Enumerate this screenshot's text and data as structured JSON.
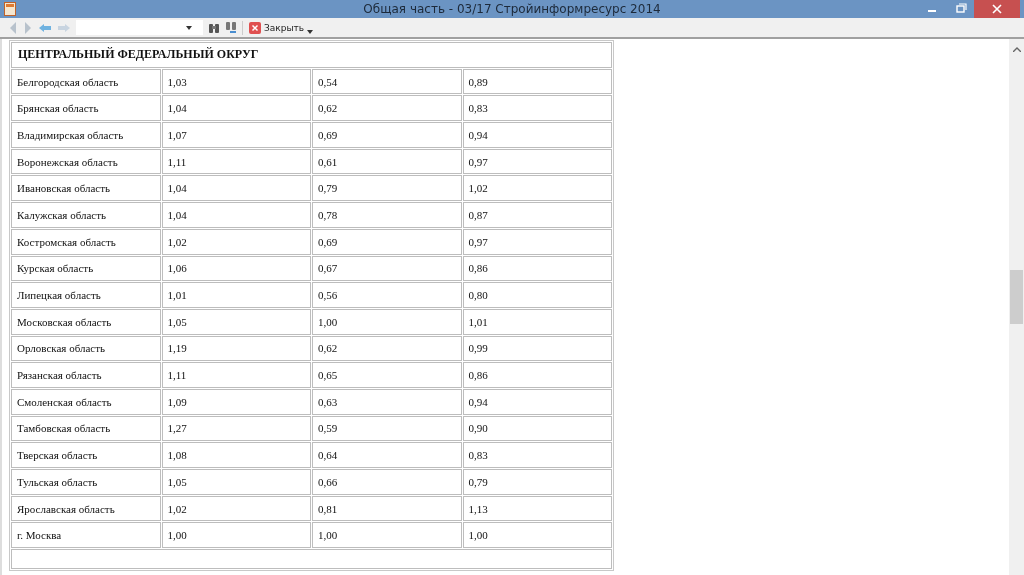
{
  "window": {
    "title": "Общая часть - 03/17 Стройинформресурс 2014"
  },
  "toolbar": {
    "close_button": {
      "label": "Закрыть"
    }
  },
  "table": {
    "section_heading": "ЦЕНТРАЛЬНЫЙ ФЕДЕРАЛЬНЫЙ ОКРУГ",
    "rows": [
      [
        "Белгородская область",
        "1,03",
        "0,54",
        "0,89"
      ],
      [
        "Брянская область",
        "1,04",
        "0,62",
        "0,83"
      ],
      [
        "Владимирская область",
        "1,07",
        "0,69",
        "0,94"
      ],
      [
        "Воронежская область",
        "1,11",
        "0,61",
        "0,97"
      ],
      [
        "Ивановская область",
        "1,04",
        "0,79",
        "1,02"
      ],
      [
        "Калужская область",
        "1,04",
        "0,78",
        "0,87"
      ],
      [
        "Костромская область",
        "1,02",
        "0,69",
        "0,97"
      ],
      [
        "Курская область",
        "1,06",
        "0,67",
        "0,86"
      ],
      [
        "Липецкая область",
        "1,01",
        "0,56",
        "0,80"
      ],
      [
        "Московская область",
        "1,05",
        "1,00",
        "1,01"
      ],
      [
        "Орловская область",
        "1,19",
        "0,62",
        "0,99"
      ],
      [
        "Рязанская область",
        "1,11",
        "0,65",
        "0,86"
      ],
      [
        "Смоленская область",
        "1,09",
        "0,63",
        "0,94"
      ],
      [
        "Тамбовская область",
        "1,27",
        "0,59",
        "0,90"
      ],
      [
        "Тверская область",
        "1,08",
        "0,64",
        "0,83"
      ],
      [
        "Тульская область",
        "1,05",
        "0,66",
        "0,79"
      ],
      [
        "Ярославская область",
        "1,02",
        "0,81",
        "1,13"
      ],
      [
        "г. Москва",
        "1,00",
        "1,00",
        "1,00"
      ]
    ]
  }
}
